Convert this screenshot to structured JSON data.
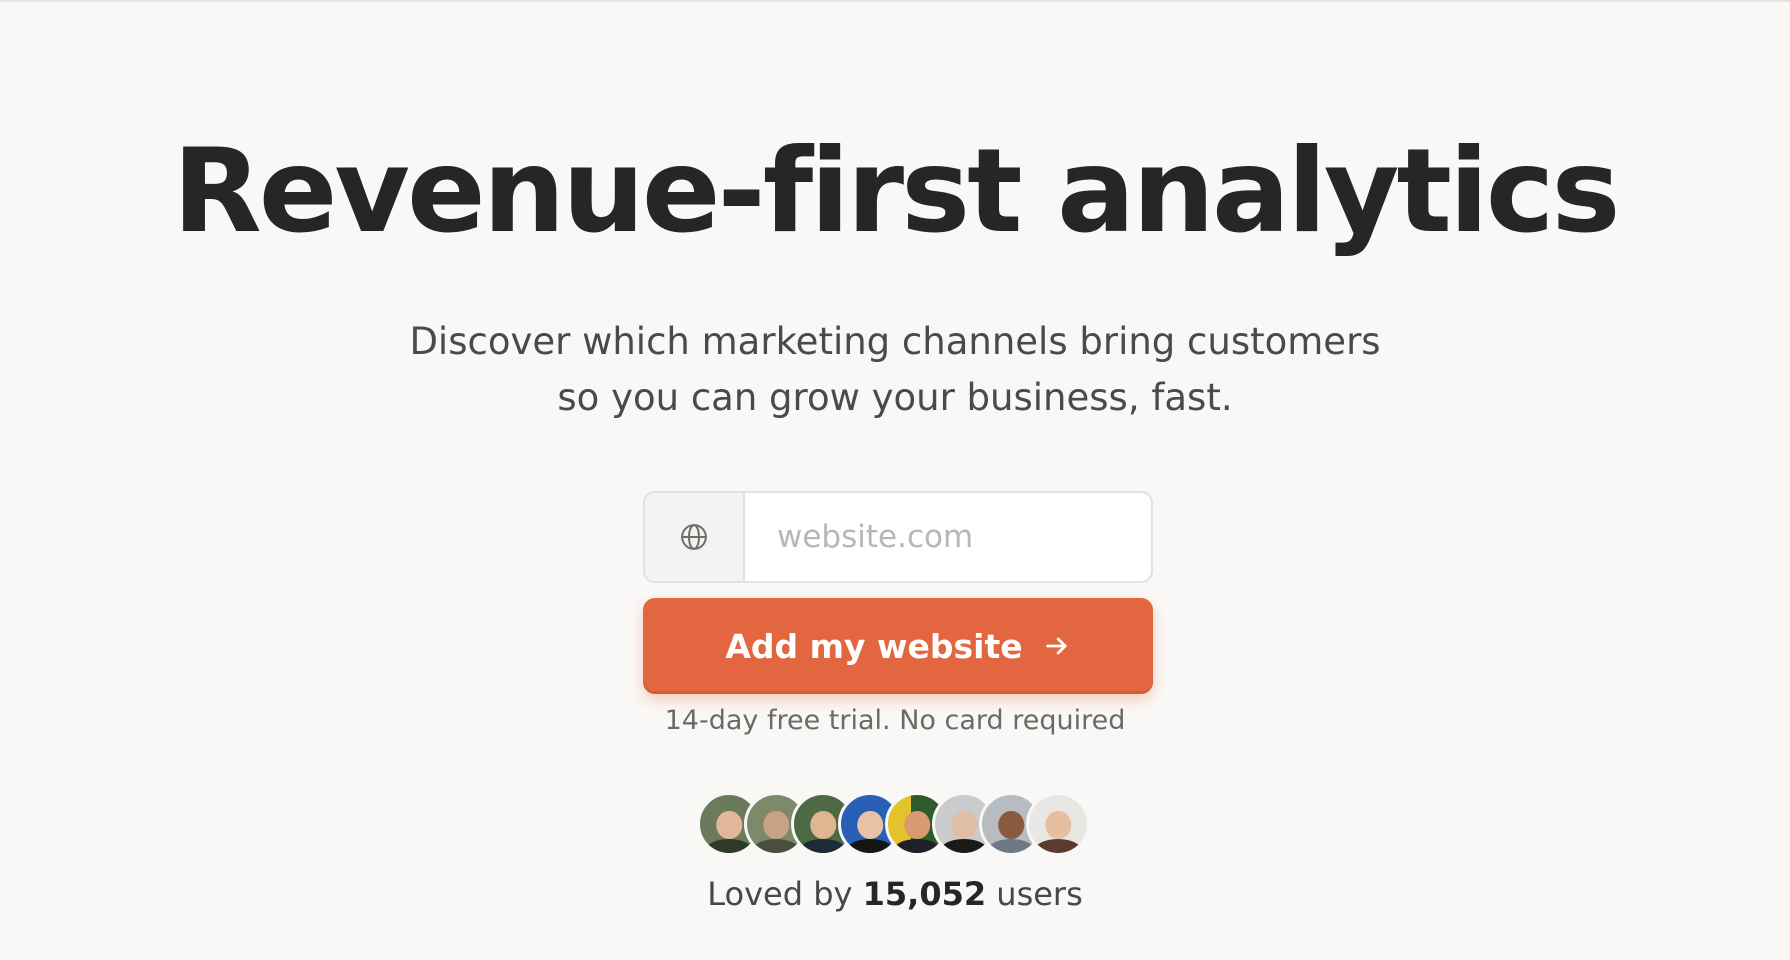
{
  "hero": {
    "headline": "Revenue-first analytics",
    "subheadline_line1": "Discover which marketing channels bring customers",
    "subheadline_line2": "so you can grow your business, fast."
  },
  "signup": {
    "website_placeholder": "website.com",
    "website_value": "",
    "prefix_icon": "globe-icon",
    "cta_label": "Add my website",
    "cta_icon": "arrow-right-icon",
    "trial_note": "14-day free trial. No card required"
  },
  "social_proof": {
    "prefix": "Loved by",
    "user_count": "15,052",
    "suffix": "users",
    "avatar_count": 8
  },
  "colors": {
    "background": "#faf8f6",
    "accent": "#e2663f",
    "headline": "#262626",
    "body_text": "#4a4a4a",
    "muted_text": "#6c6a67"
  }
}
